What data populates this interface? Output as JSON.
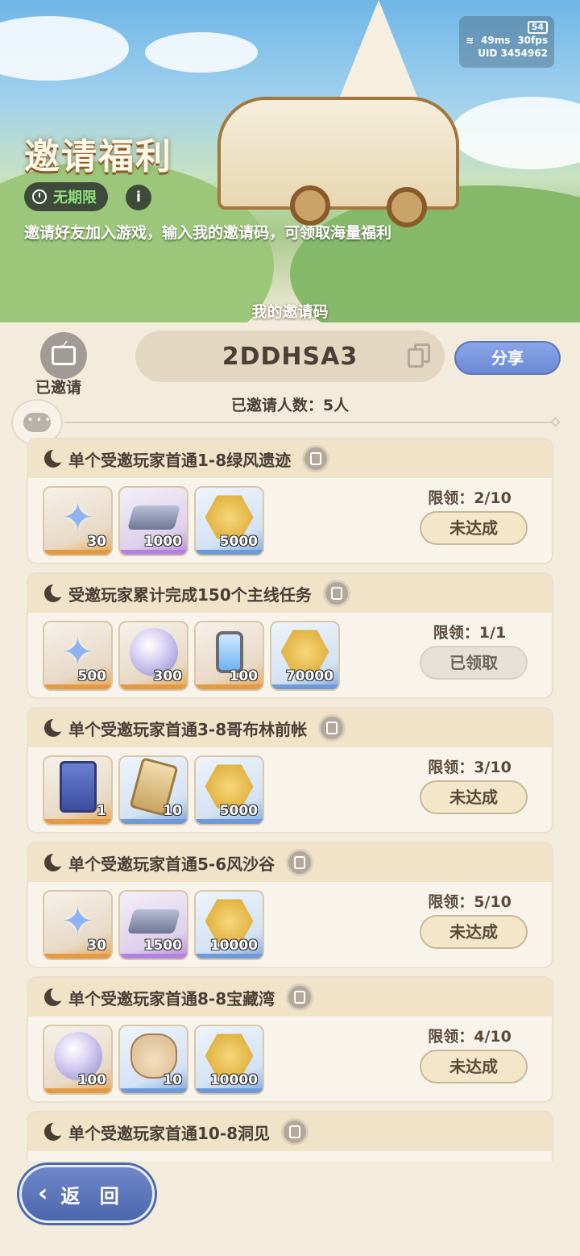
{
  "status": {
    "battery": "54",
    "ping": "49ms",
    "fps": "30fps",
    "uid": "UID 3454962"
  },
  "header": {
    "title": "邀请福利",
    "period": "无期限",
    "info_icon": "i",
    "description": "邀请好友加入游戏，输入我的邀请码，可领取海量福利"
  },
  "invite": {
    "caption": "我的邀请码",
    "invited_label": "已邀请",
    "code": "2DDHSA3",
    "share_label": "分享",
    "count_text": "已邀请人数：5人"
  },
  "tasks": [
    {
      "title": "单个受邀玩家首通1-8绿风遗迹",
      "limit": "限领：2/10",
      "status": "未达成",
      "rewards": [
        {
          "icon": "star-crystal",
          "rarity": "orange",
          "qty": "30"
        },
        {
          "icon": "iron-ingot",
          "rarity": "purple",
          "qty": "1000"
        },
        {
          "icon": "gold-coin",
          "rarity": "blue",
          "qty": "5000"
        }
      ]
    },
    {
      "title": "受邀玩家累计完成150个主线任务",
      "limit": "限领：1/1",
      "status": "已领取",
      "rewards": [
        {
          "icon": "star-crystal",
          "rarity": "orange",
          "qty": "500"
        },
        {
          "icon": "crystal-orb",
          "rarity": "orange",
          "qty": "300"
        },
        {
          "icon": "energy-cell",
          "rarity": "orange",
          "qty": "100"
        },
        {
          "icon": "gold-coin",
          "rarity": "blue",
          "qty": "70000"
        }
      ]
    },
    {
      "title": "单个受邀玩家首通3-8哥布林前帐",
      "limit": "限领：3/10",
      "status": "未达成",
      "rewards": [
        {
          "icon": "summon-card",
          "rarity": "orange",
          "qty": "1"
        },
        {
          "icon": "gold-card",
          "rarity": "blue",
          "qty": "10"
        },
        {
          "icon": "gold-coin",
          "rarity": "blue",
          "qty": "5000"
        }
      ]
    },
    {
      "title": "单个受邀玩家首通5-6风沙谷",
      "limit": "限领：5/10",
      "status": "未达成",
      "rewards": [
        {
          "icon": "star-crystal",
          "rarity": "orange",
          "qty": "30"
        },
        {
          "icon": "iron-ingot",
          "rarity": "purple",
          "qty": "1500"
        },
        {
          "icon": "gold-coin",
          "rarity": "blue",
          "qty": "10000"
        }
      ]
    },
    {
      "title": "单个受邀玩家首通8-8宝藏湾",
      "limit": "限领：4/10",
      "status": "未达成",
      "rewards": [
        {
          "icon": "crystal-orb",
          "rarity": "orange",
          "qty": "100"
        },
        {
          "icon": "pet-food-sack",
          "rarity": "blue",
          "qty": "10"
        },
        {
          "icon": "gold-coin",
          "rarity": "blue",
          "qty": "10000"
        }
      ]
    },
    {
      "title": "单个受邀玩家首通10-8洞见",
      "limit": "",
      "status": "",
      "rewards": []
    }
  ],
  "back_label": "返 回"
}
